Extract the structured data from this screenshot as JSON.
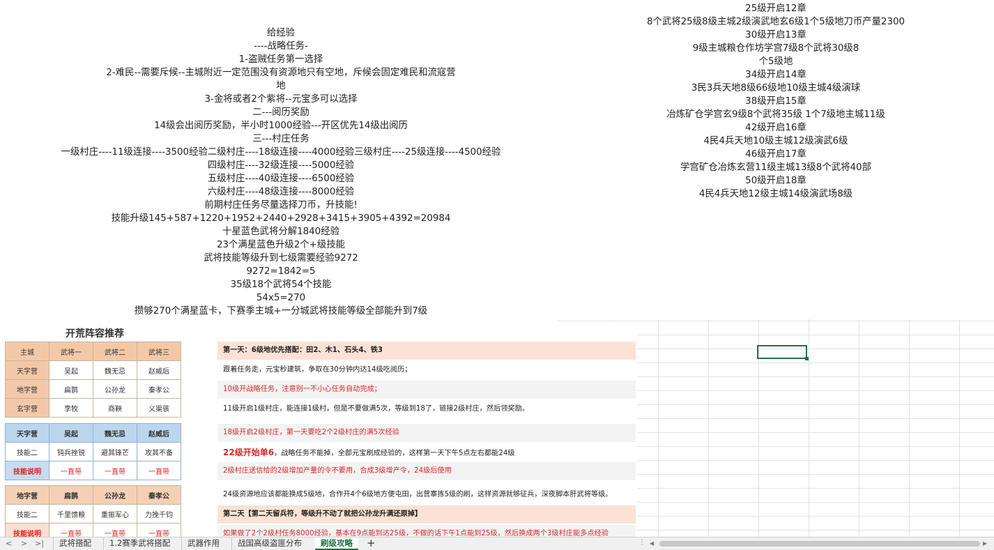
{
  "left_lines": [
    "给经验",
    "----战略任务-",
    "1-盗贼任务第一选择",
    "2-难民--需要斥候--主城附近一定范围没有资源地只有空地，斥候会固定难民和流寇营",
    "地",
    "3-金将或者2个紫将--元宝多可以选择",
    "二---阅历奖励",
    "14级会出阅历奖励，半小时1000经验---开区优先14级出阅历",
    "三---村庄任务",
    "一级村庄----11级连接----3500经验二级村庄----18级连接----4000经验三级村庄----25级连接----4500经验",
    "四级村庄----32级连接----5000经验",
    "五级村庄----40级连接----6500经验",
    "六级村庄----48级连接----8000经验",
    "前期村庄任务尽量选择刀币，升技能!",
    "技能升级145+587+1220+1952+2440+2928+3415+3905+4392=20984",
    "十星蓝色武将分解1840经验",
    "23个满星蓝色升级2个+级技能",
    "武将技能等级升到七级需要经验9272",
    "9272=1842=5",
    "35级18个武将54个技能",
    "54x5=270",
    "攒够270个满星蓝卡，下赛季主城+一分城武将技能等级全部能升到7级"
  ],
  "right_lines": [
    "25级开启12章",
    "8个武将25级8级主城2级演武地玄6级1个5级地刀币产量2300",
    "30级开启13章",
    "9级主城粮仓作坊学宫7级8个武将30级8",
    "个5级地",
    "34级开启14章",
    "3民3兵天地8级66级地10级主城4级演球",
    "38级开启15章",
    "冶炼矿仓学宫玄9级8个武将35级 1个7级地主城11级",
    "42级开启16章",
    "4民4兵天地10级主城12级演武6级",
    "46级开启17章",
    "学宫矿仓冶炼玄营11级主城13级8个武将40部",
    "50级开启18章",
    "4民4兵天地12级主城14级演武场8级"
  ],
  "picture": {
    "title": "开荒阵容推荐",
    "table1": [
      [
        "主城",
        "武将一",
        "武将二",
        "武将三"
      ],
      [
        "天字营",
        "吴起",
        "魏无忌",
        "赵威后"
      ],
      [
        "地字营",
        "扁鹊",
        "公孙龙",
        "秦孝公"
      ],
      [
        "玄字营",
        "李牧",
        "商鞅",
        "义渠骇"
      ]
    ],
    "table2": [
      [
        "天字营",
        "吴起",
        "魏无忌",
        "赵威后"
      ],
      [
        "技能二",
        "钝兵挫锐",
        "避其锋芒",
        "攻其不备"
      ],
      [
        "技能说明",
        "一直带",
        "一直带",
        "一直带"
      ]
    ],
    "table3": [
      [
        "地字营",
        "扁鹊",
        "公孙龙",
        "秦孝公"
      ],
      [
        "技能二",
        "千里馈粮",
        "重振军心",
        "力挽千钧"
      ],
      [
        "技能说明",
        "一直带",
        "一直带",
        "一直带"
      ]
    ],
    "notes": [
      "第一天：6级地优先搭配：田2、木1、石头4、铁3",
      "跟着任务走，元宝秒建筑，争取在30分钟内达14级吃阅历；",
      "10级开战略任务，注意别一不小心任务自动完成；",
      "11级开启1级村庄，能连接1级村，但是不要做满5次，等级到18了，链接2级村庄，然后领奖励。",
      "18级开启2级村庄，第一天要吃2个2级村庄的满5次经验",
      "22级开始单6",
      "，战略任务不能掉，全部元宝刷成经验的，这样第一天下午5点左右都能24级",
      "2级村庄送信给的2级增加产量的令不要用，合成3级增产令，24级后使用",
      "24级资源地应该都能换成5级地，合作开4个6级地方便屯田，出营寨拣5级的刷，这样资源就够征兵，深夜脚本肝武将等级。",
      "第二天【第二天留兵符，等级升不动了就把公孙龙升满还原掉】",
      "如果做了2个2级村任务8000经验，基本在9点能到达25级，不做的话下午1点能到25级，然后换成两个3级村庄能多点经验"
    ]
  },
  "tabs": {
    "nav": [
      "<",
      ">",
      ">|"
    ],
    "sheets": [
      "武将搭配",
      "1.2赛季武将搭配",
      "武器作用",
      "战国高级盗匪分布",
      "刷级攻略"
    ],
    "active": "刷级攻略",
    "add": "+"
  },
  "colors": {
    "accent": "#217346",
    "header_peach": "#f3c8a8",
    "header_blue": "#bcd6ee",
    "note_red": "#d62828"
  }
}
